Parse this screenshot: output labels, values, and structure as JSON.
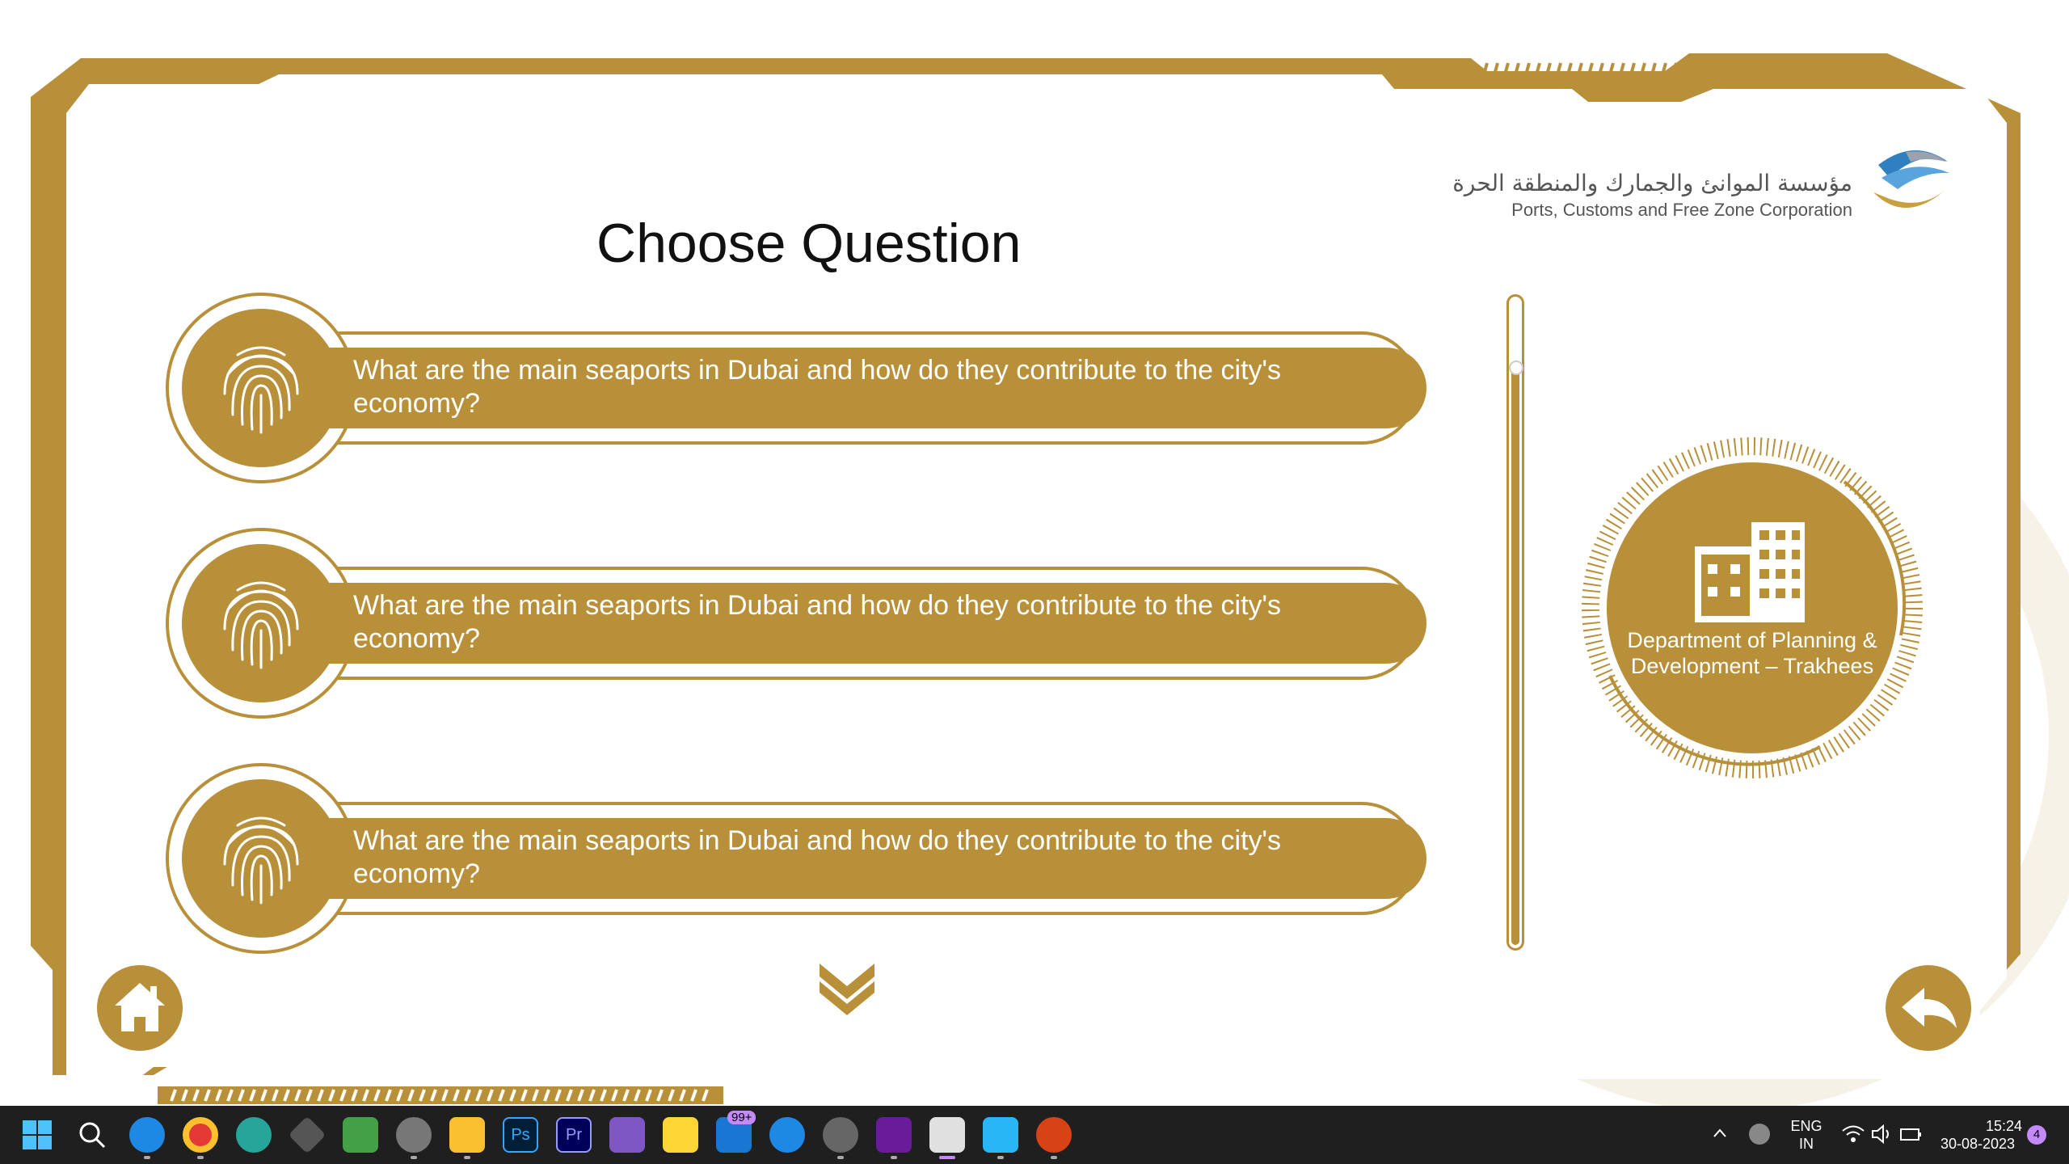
{
  "page_title": "Choose Question",
  "logo": {
    "arabic": "مؤسسة الموانئ والجمارك والمنطقة الحرة",
    "english": "Ports, Customs and Free Zone Corporation"
  },
  "questions": [
    {
      "text": "What are the main seaports in Dubai and how do they contribute to the city's economy?"
    },
    {
      "text": "What are the main seaports in Dubai and how do they contribute to the city's economy?"
    },
    {
      "text": "What are the main seaports in Dubai and how do they contribute to the city's economy?"
    }
  ],
  "department": {
    "label": "Department of Planning & Development – Trakhees",
    "icon": "building-icon"
  },
  "navigation": {
    "home_icon": "home-icon",
    "back_icon": "back-arrow-icon",
    "more_icon": "double-chevron-down-icon"
  },
  "colors": {
    "gold": "#b8903a",
    "background": "#ffffff",
    "taskbar": "#1f1f1f"
  },
  "taskbar": {
    "language_line1": "ENG",
    "language_line2": "IN",
    "time": "15:24",
    "date": "30-08-2023",
    "notification_count": "4",
    "mail_badge": "99+"
  }
}
